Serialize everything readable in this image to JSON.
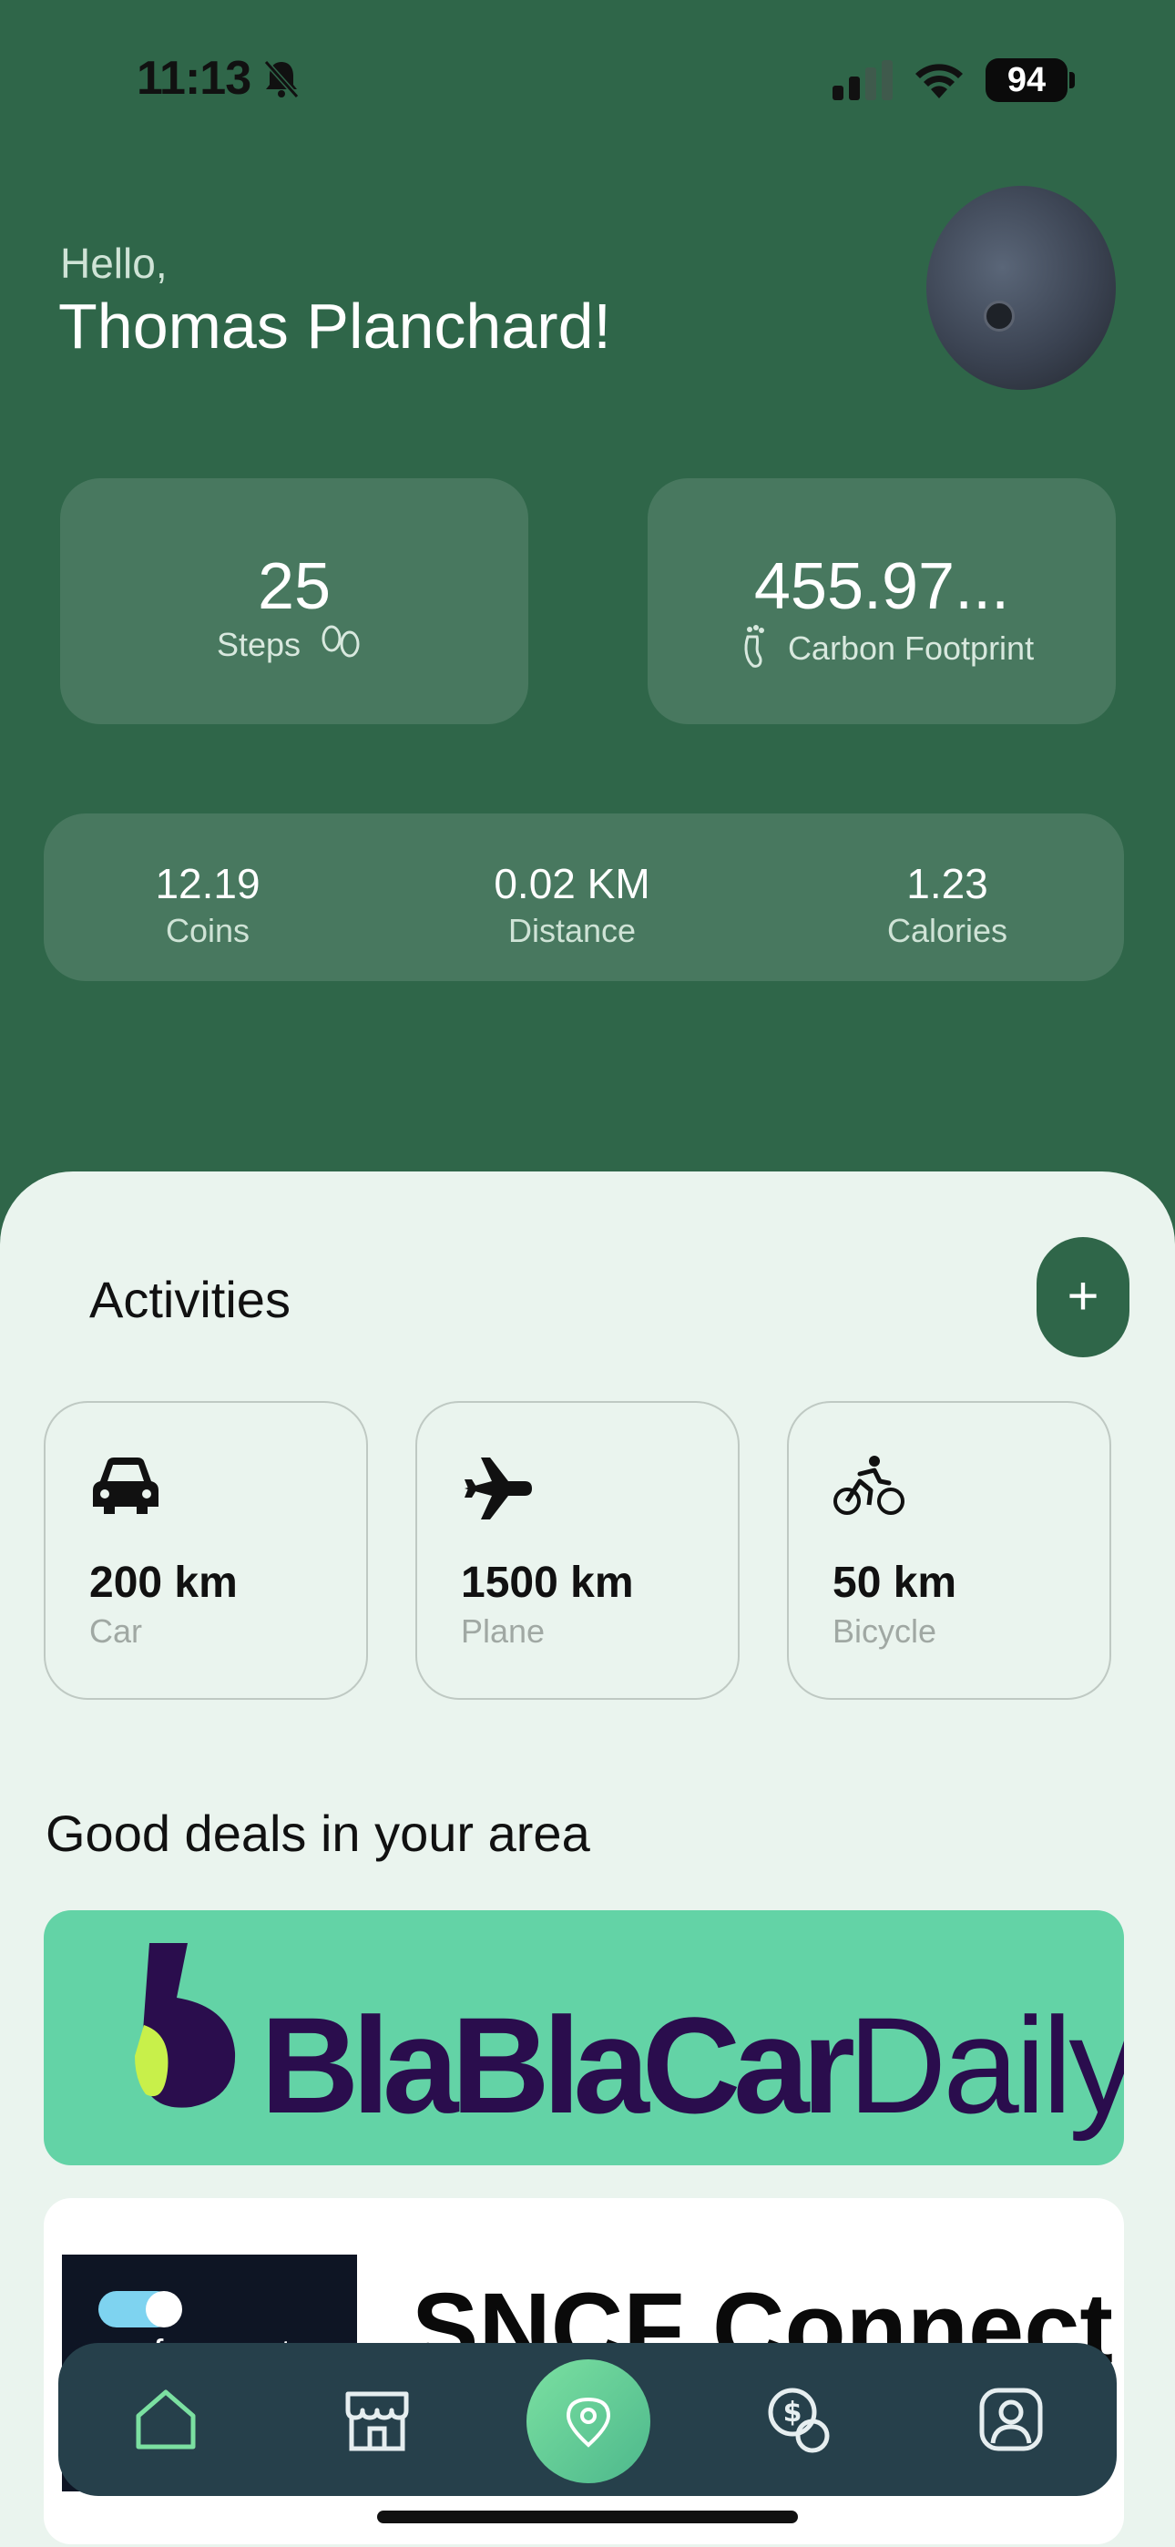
{
  "status_bar": {
    "time": "11:13",
    "battery": "94"
  },
  "header": {
    "greeting": "Hello,",
    "name": "Thomas Planchard!"
  },
  "stats": {
    "steps": {
      "value": "25",
      "label": "Steps"
    },
    "carbon": {
      "value": "455.97...",
      "label": "Carbon Footprint"
    }
  },
  "summary": [
    {
      "value": "12.19",
      "label": "Coins"
    },
    {
      "value": "0.02 KM",
      "label": "Distance"
    },
    {
      "value": "1.23",
      "label": "Calories"
    }
  ],
  "activities": {
    "title": "Activities",
    "add_label": "+",
    "items": [
      {
        "distance": "200 km",
        "mode": "Car",
        "icon": "car-icon"
      },
      {
        "distance": "1500 km",
        "mode": "Plane",
        "icon": "plane-icon"
      },
      {
        "distance": "50 km",
        "mode": "Bicycle",
        "icon": "bicycle-icon"
      }
    ]
  },
  "deals": {
    "title": "Good deals in your area",
    "items": [
      {
        "brand": "BlaBlaCar",
        "brand_suffix": "Daily",
        "bg": "#63D3A6"
      },
      {
        "brand": "SNCF Connect",
        "logo_text": "sncfconnect",
        "bg": "#FFFFFF"
      }
    ]
  },
  "tabbar": {
    "items": [
      "home-icon",
      "store-icon",
      "location-icon",
      "coin-icon",
      "profile-icon"
    ],
    "active": "home-icon"
  },
  "colors": {
    "primary": "#2F6649",
    "sheet": "#EAF4EE",
    "tabbar": "#26404B",
    "accent": "#7BE0A1"
  }
}
